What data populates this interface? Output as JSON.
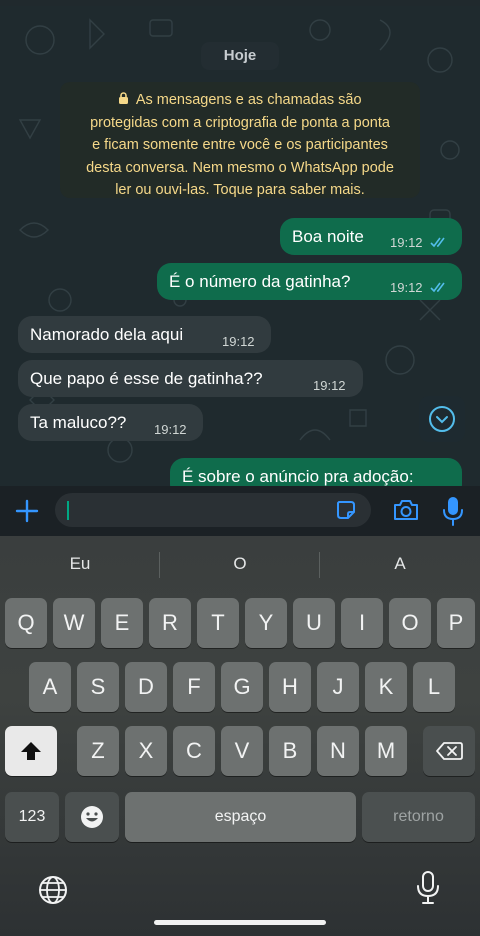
{
  "colors": {
    "outgoing_bubble": "#0f6c4c",
    "incoming_bubble": "#313b3f",
    "accent_blue": "#53bdeb",
    "notice_text": "#f5d889",
    "chat_background": "#1f2a2e"
  },
  "chat": {
    "date_label": "Hoje",
    "encryption_notice": {
      "lines": [
        "As mensagens e as chamadas são",
        "protegidas com a criptografia de ponta a ponta",
        "e ficam somente entre você e os participantes",
        "desta conversa. Nem mesmo o WhatsApp pode",
        "ler ou ouvi-las. Toque para saber mais."
      ],
      "icon": "lock-icon"
    },
    "messages": [
      {
        "direction": "out",
        "text": "Boa noite",
        "time": "19:12",
        "status": "read"
      },
      {
        "direction": "out",
        "text": "É o número da gatinha?",
        "time": "19:12",
        "status": "read"
      },
      {
        "direction": "in",
        "text": "Namorado dela aqui",
        "time": "19:12"
      },
      {
        "direction": "in",
        "text": "Que papo é esse de gatinha??",
        "time": "19:12"
      },
      {
        "direction": "in",
        "text": "Ta maluco??",
        "time": "19:12"
      },
      {
        "direction": "out",
        "text": "É sobre o anúncio pra adoção:",
        "time": "",
        "status": ""
      }
    ],
    "scroll_button_icon": "chevron-down-icon"
  },
  "input_bar": {
    "attach_icon": "plus-icon",
    "sticker_icon": "sticker-icon",
    "camera_icon": "camera-icon",
    "mic_icon": "microphone-icon",
    "value": ""
  },
  "keyboard": {
    "suggestions": [
      "Eu",
      "O",
      "A"
    ],
    "rows": [
      [
        "Q",
        "W",
        "E",
        "R",
        "T",
        "Y",
        "U",
        "I",
        "O",
        "P"
      ],
      [
        "A",
        "S",
        "D",
        "F",
        "G",
        "H",
        "J",
        "K",
        "L"
      ],
      [
        "Z",
        "X",
        "C",
        "V",
        "B",
        "N",
        "M"
      ]
    ],
    "shift_icon": "shift-icon",
    "backspace_icon": "backspace-icon",
    "numbers_label": "123",
    "emoji_icon": "emoji-icon",
    "space_label": "espaço",
    "return_label": "retorno",
    "globe_icon": "globe-icon",
    "dictation_icon": "microphone-icon"
  }
}
